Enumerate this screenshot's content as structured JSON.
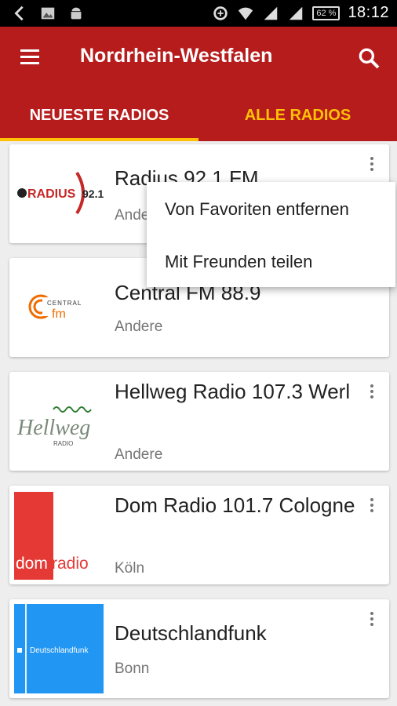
{
  "status_bar": {
    "time": "18:12",
    "battery": "62 %",
    "left_icons": [
      "back-icon",
      "image-icon",
      "android-icon"
    ],
    "right_icons": [
      "data-saver-icon",
      "wifi-icon",
      "signal-icon",
      "signal-2-icon",
      "battery-icon"
    ]
  },
  "app_bar": {
    "title": "Nordrhein-Westfalen",
    "color": "#b71c1c",
    "accent": "#ffc107"
  },
  "tabs": [
    {
      "label": "NEUESTE RADIOS",
      "active": true
    },
    {
      "label": "ALLE RADIOS",
      "active": false
    }
  ],
  "stations": [
    {
      "name": "Radius 92.1 FM",
      "category": "Andere",
      "logo": "radius-92-1-logo",
      "logo_text": "RADIUS 92.1"
    },
    {
      "name": "Central FM 88.9",
      "category": "Andere",
      "logo": "central-fm-logo",
      "logo_text": "CENTRAL fm"
    },
    {
      "name": "Hellweg Radio 107.3 Werl",
      "category": "Andere",
      "logo": "hellweg-radio-logo",
      "logo_text": "Hellweg RADIO"
    },
    {
      "name": "Dom Radio 101.7 Cologne",
      "category": "Köln",
      "logo": "domradio-logo",
      "logo_text": "domradio"
    },
    {
      "name": "Deutschlandfunk",
      "category": "Bonn",
      "logo": "deutschlandfunk-logo",
      "logo_text": "Deutschlandfunk"
    }
  ],
  "popup_menu": {
    "items": [
      "Von Favoriten entfernen",
      "Mit Freunden teilen"
    ]
  }
}
